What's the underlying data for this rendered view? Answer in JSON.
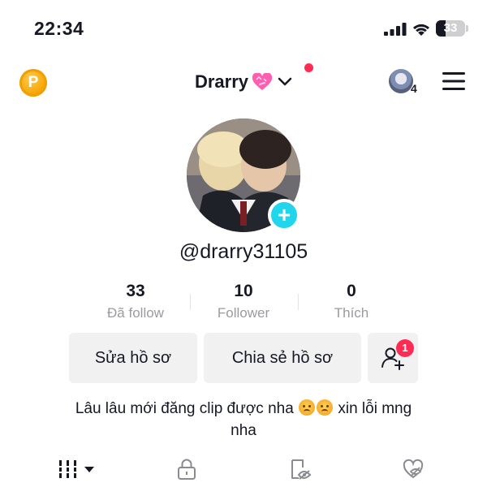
{
  "status_bar": {
    "time": "22:34",
    "battery": "33",
    "battery_level": 0.33
  },
  "header": {
    "coin_letter": "P",
    "username": "Drarry",
    "inbox_count": "4",
    "icons": [
      "coin-icon",
      "heart-emoji-icon",
      "chevron-down-icon",
      "friend-avatar",
      "menu-icon"
    ]
  },
  "profile": {
    "handle": "@drarry31105",
    "add_icon": "plus-icon"
  },
  "stats": [
    {
      "value": "33",
      "label": "Đã follow"
    },
    {
      "value": "10",
      "label": "Follower"
    },
    {
      "value": "0",
      "label": "Thích"
    }
  ],
  "actions": {
    "edit_profile": "Sửa hồ sơ",
    "share_profile": "Chia sẻ hồ sơ",
    "add_friend_badge": "1"
  },
  "bio": {
    "line1_before": "Lâu lâu mới đăng clip được nha",
    "line1_after": "xin lỗi mng",
    "line2": "nha"
  },
  "tabs": [
    "videos-grid-icon",
    "lock-icon",
    "reposts-icon",
    "liked-icon"
  ],
  "colors": {
    "accent_red": "#fe2c55",
    "accent_cyan": "#20d5ec",
    "button_bg": "#f1f1f2",
    "muted_text": "#9a9ba0"
  }
}
